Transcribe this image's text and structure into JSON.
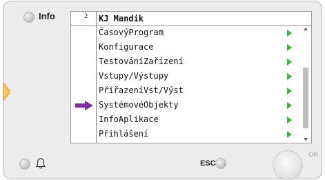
{
  "panel": {
    "info_label": "Info",
    "esc_label": "ESC",
    "ok_label": "OK"
  },
  "screen": {
    "level": "2",
    "title": "KJ Mandík",
    "selected_index": 5,
    "items": [
      {
        "label": "ČasovýProgram"
      },
      {
        "label": "Konfigurace"
      },
      {
        "label": "TestováníZařízení"
      },
      {
        "label": "Vstupy/Výstupy"
      },
      {
        "label": "PřiřazeníVst/Výst"
      },
      {
        "label": "SystémovéObjekty"
      },
      {
        "label": "InfoAplikace"
      },
      {
        "label": "Přihlášení"
      }
    ]
  },
  "icons": {
    "info_led": "led-indicator",
    "alarm_led": "led-indicator",
    "bell": "bell-icon",
    "esc_led": "led-indicator",
    "submenu_arrow": "triangle-right-icon",
    "selection": "arrow-right-icon",
    "nav": "arrow-right-icon"
  },
  "colors": {
    "submenu_arrow": "#3bb53b",
    "selection_arrow": "#7a2fa4",
    "nav_arrow": "#f6c65c",
    "housing": "#ececec"
  }
}
